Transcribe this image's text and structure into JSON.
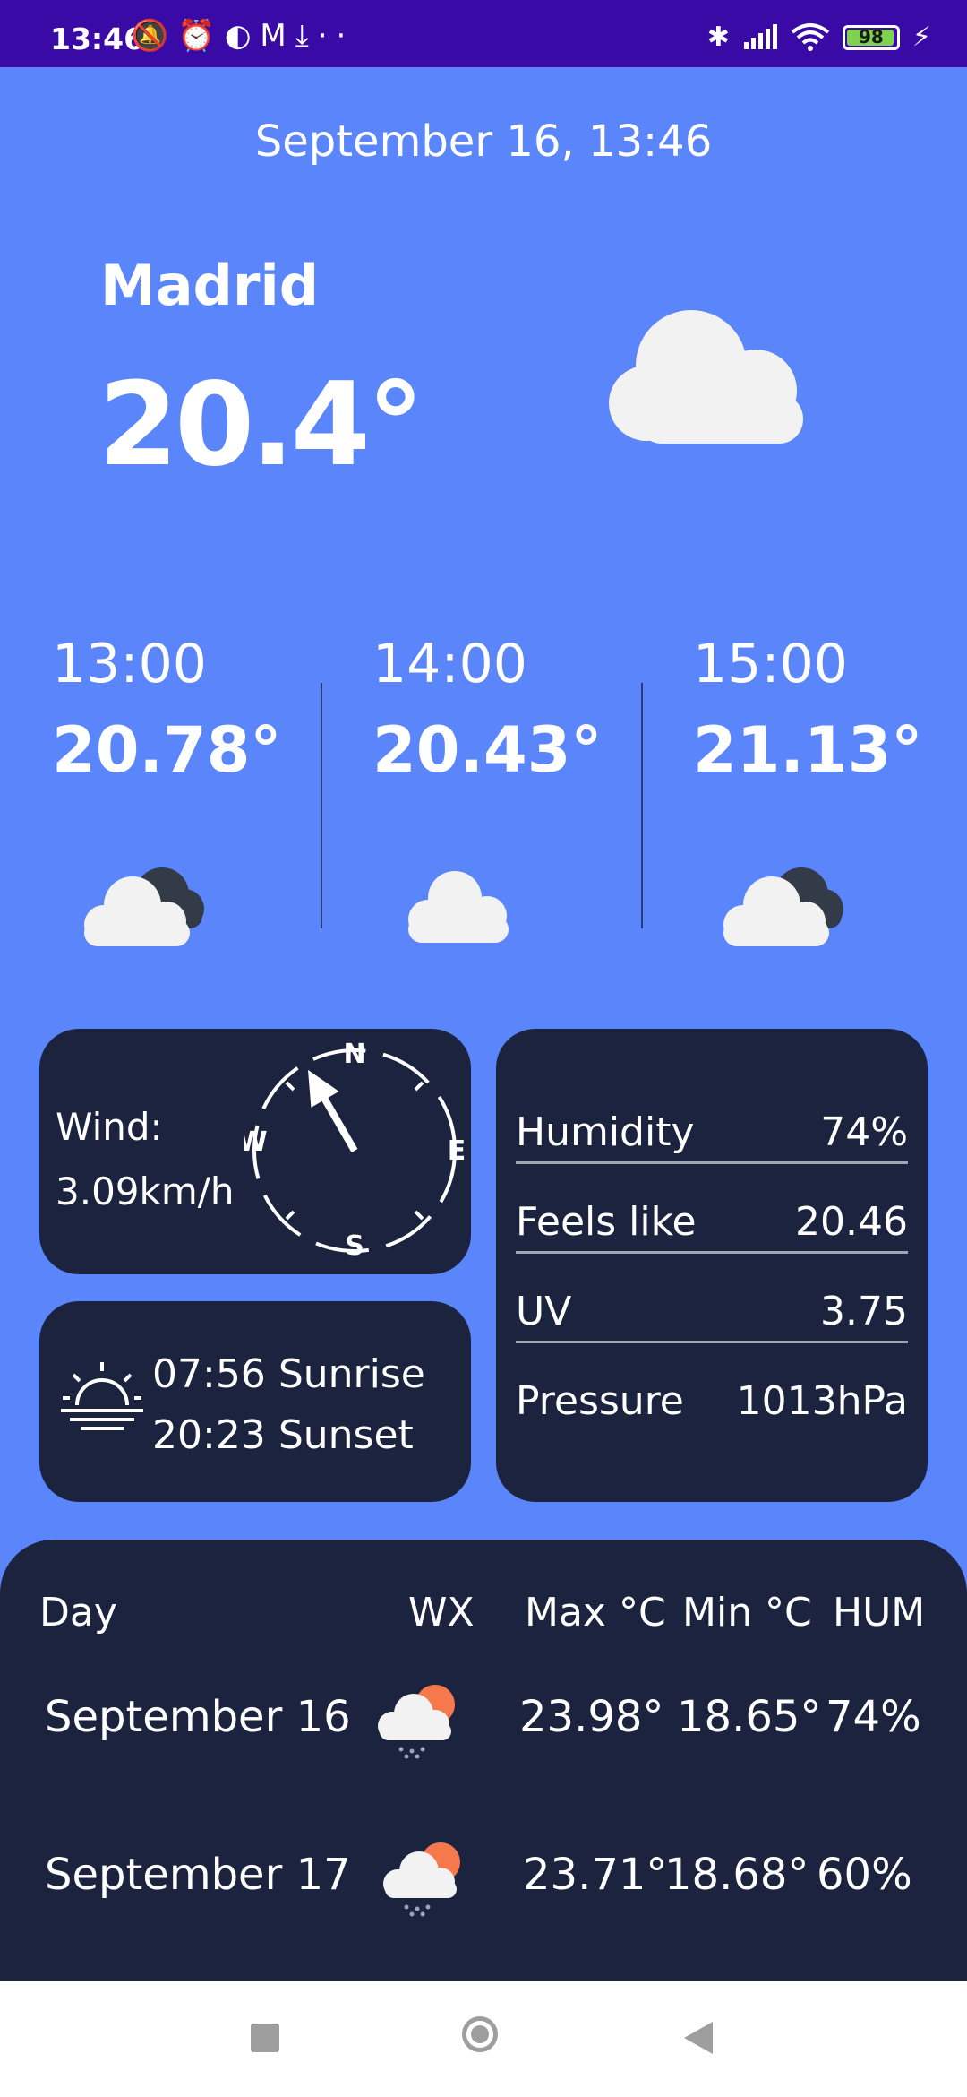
{
  "status_bar": {
    "time": "13:46",
    "left_icons": [
      "muted-bell-icon",
      "alarm-icon",
      "app-icon",
      "gmail-icon",
      "download-icon",
      "more-dots-icon"
    ],
    "right_icons": [
      "bluetooth-icon",
      "signal-icon",
      "wifi-icon",
      "battery-icon",
      "charging-icon"
    ],
    "battery": "98"
  },
  "header": {
    "datetime": "September 16, 13:46",
    "city": "Madrid",
    "temperature": "20.4°",
    "icon": "cloud-icon"
  },
  "hourly": [
    {
      "time": "13:00",
      "temp": "20.78°",
      "icon": "cloud-dark-icon"
    },
    {
      "time": "14:00",
      "temp": "20.43°",
      "icon": "cloud-icon"
    },
    {
      "time": "15:00",
      "temp": "21.13°",
      "icon": "cloud-dark-icon"
    }
  ],
  "wind": {
    "label": "Wind:",
    "speed": "3.09km/h",
    "compass": {
      "n": "N",
      "e": "E",
      "s": "S",
      "w": "W"
    },
    "direction_deg": 330
  },
  "sun": {
    "sunrise_time": "07:56",
    "sunrise_label": "Sunrise",
    "sunset_time": "20:23",
    "sunset_label": "Sunset"
  },
  "stats": [
    {
      "label": "Humidity",
      "value": "74%"
    },
    {
      "label": "Feels like",
      "value": "20.46"
    },
    {
      "label": "UV",
      "value": "3.75"
    },
    {
      "label": "Pressure",
      "value": "1013hPa"
    }
  ],
  "forecast": {
    "headers": {
      "day": "Day",
      "wx": "WX",
      "max": "Max °C",
      "min": "Min °C",
      "hum": "HUM"
    },
    "rows": [
      {
        "day": "September 16",
        "icon": "cloud-sun-rain-icon",
        "max": "23.98°",
        "min": "18.65°",
        "hum": "74%"
      },
      {
        "day": "September 17",
        "icon": "cloud-sun-rain-icon",
        "max": "23.71°",
        "min": "18.68°",
        "hum": "60%"
      }
    ]
  },
  "colors": {
    "background": "#5b86fb",
    "status_bar": "#3a0aa6",
    "card": "#1b233f",
    "battery": "#7fd24b",
    "sun": "#f5794c"
  }
}
